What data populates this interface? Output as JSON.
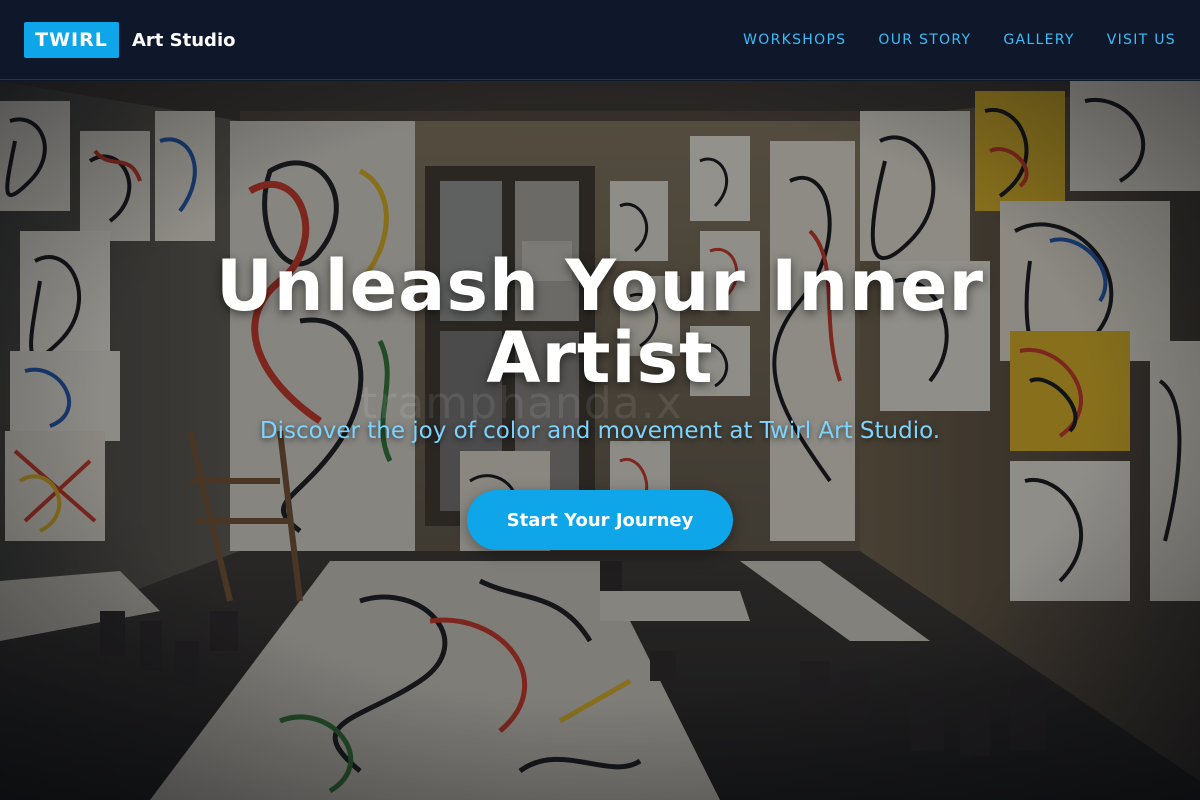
{
  "header": {
    "logo_badge": "TWIRL",
    "logo_text": "Art Studio",
    "nav": [
      {
        "label": "WORKSHOPS"
      },
      {
        "label": "OUR STORY"
      },
      {
        "label": "GALLERY"
      },
      {
        "label": "VISIT US"
      }
    ]
  },
  "hero": {
    "title": "Unleash Your Inner Artist",
    "subtitle": "Discover the joy of color and movement at Twirl Art Studio.",
    "cta_label": "Start Your Journey",
    "watermark": "tramphanda.x"
  },
  "colors": {
    "accent": "#0ea5e9",
    "nav_link": "#38bdf8",
    "subtitle": "#7dd3fc",
    "header_bg": "#0f172a"
  }
}
